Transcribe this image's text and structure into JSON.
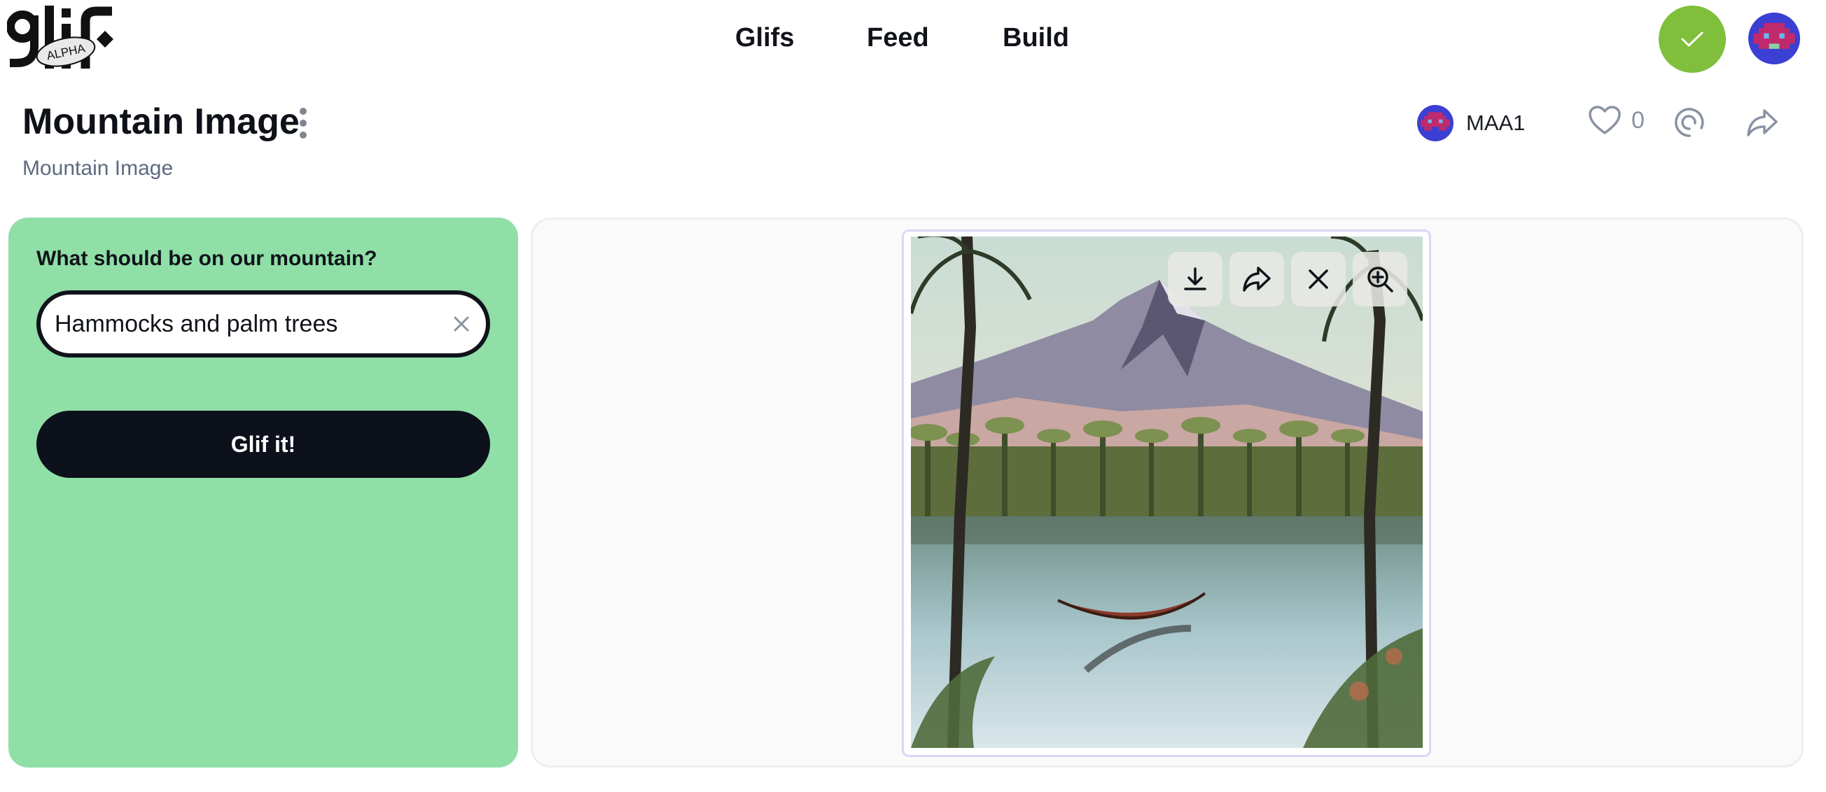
{
  "nav": {
    "logo_text": "glif",
    "logo_badge": "ALPHA",
    "links": [
      {
        "label": "Glifs"
      },
      {
        "label": "Feed"
      },
      {
        "label": "Build"
      }
    ]
  },
  "header": {
    "title": "Mountain Image",
    "subtitle": "Mountain Image",
    "author": "MAA1",
    "like_count": "0"
  },
  "form": {
    "label": "What should be on our mountain?",
    "input_value": "Hammocks and palm trees",
    "submit_label": "Glif it!"
  },
  "colors": {
    "panel_green": "#8fdfa7",
    "button_dark": "#0c111c",
    "status_green": "#7fbf3c"
  },
  "icons": [
    "check-icon",
    "kebab-menu-icon",
    "heart-icon",
    "remix-icon",
    "share-icon",
    "clear-icon",
    "download-icon",
    "close-icon",
    "zoom-in-icon"
  ]
}
